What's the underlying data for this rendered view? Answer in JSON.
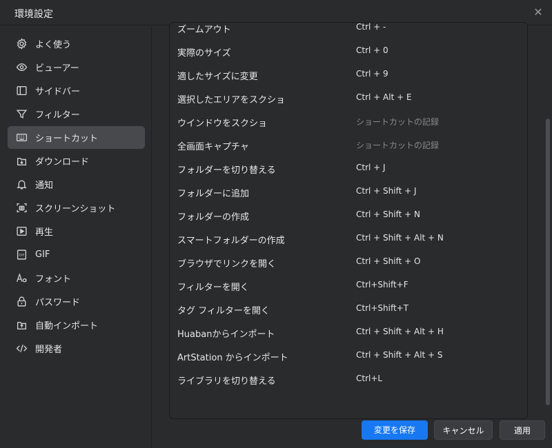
{
  "window": {
    "title": "環境設定",
    "close_icon": "close-icon"
  },
  "sidebar": {
    "items": [
      {
        "label": "よく使う",
        "icon": "gear-icon",
        "active": false
      },
      {
        "label": "ビューアー",
        "icon": "eye-icon",
        "active": false
      },
      {
        "label": "サイドバー",
        "icon": "sidebar-icon",
        "active": false
      },
      {
        "label": "フィルター",
        "icon": "filter-icon",
        "active": false
      },
      {
        "label": "ショートカット",
        "icon": "keyboard-icon",
        "active": true
      },
      {
        "label": "ダウンロード",
        "icon": "download-icon",
        "active": false
      },
      {
        "label": "通知",
        "icon": "bell-icon",
        "active": false
      },
      {
        "label": "スクリーンショット",
        "icon": "screenshot-icon",
        "active": false
      },
      {
        "label": "再生",
        "icon": "play-icon",
        "active": false
      },
      {
        "label": "GIF",
        "icon": "gif-icon",
        "active": false
      },
      {
        "label": "フォント",
        "icon": "font-icon",
        "active": false
      },
      {
        "label": "パスワード",
        "icon": "lock-icon",
        "active": false
      },
      {
        "label": "自動インポート",
        "icon": "import-icon",
        "active": false
      },
      {
        "label": "開発者",
        "icon": "code-icon",
        "active": false
      }
    ]
  },
  "shortcuts": [
    {
      "name": "ズームアウト",
      "key": "Ctrl + -",
      "placeholder": false
    },
    {
      "name": "実際のサイズ",
      "key": "Ctrl + 0",
      "placeholder": false
    },
    {
      "name": "適したサイズに変更",
      "key": "Ctrl + 9",
      "placeholder": false
    },
    {
      "name": "選択したエリアをスクショ",
      "key": "Ctrl + Alt + E",
      "placeholder": false
    },
    {
      "name": "ウインドウをスクショ",
      "key": "ショートカットの記録",
      "placeholder": true
    },
    {
      "name": "全画面キャプチャ",
      "key": "ショートカットの記録",
      "placeholder": true
    },
    {
      "name": "フォルダーを切り替える",
      "key": "Ctrl + J",
      "placeholder": false
    },
    {
      "name": "フォルダーに追加",
      "key": "Ctrl + Shift + J",
      "placeholder": false
    },
    {
      "name": "フォルダーの作成",
      "key": "Ctrl + Shift + N",
      "placeholder": false
    },
    {
      "name": "スマートフォルダーの作成",
      "key": "Ctrl + Shift + Alt + N",
      "placeholder": false
    },
    {
      "name": "ブラウザでリンクを開く",
      "key": "Ctrl + Shift + O",
      "placeholder": false
    },
    {
      "name": "フィルターを開く",
      "key": "Ctrl+Shift+F",
      "placeholder": false
    },
    {
      "name": "タグ フィルターを開く",
      "key": "Ctrl+Shift+T",
      "placeholder": false
    },
    {
      "name": "Huabanからインポート",
      "key": "Ctrl + Shift + Alt + H",
      "placeholder": false
    },
    {
      "name": "ArtStation からインポート",
      "key": "Ctrl + Shift + Alt + S",
      "placeholder": false
    },
    {
      "name": "ライブラリを切り替える",
      "key": "Ctrl+L",
      "placeholder": false
    }
  ],
  "footer": {
    "save_label": "変更を保存",
    "cancel_label": "キャンセル",
    "apply_label": "適用"
  },
  "colors": {
    "background": "#2a2b2d",
    "active_item": "#47494d",
    "primary": "#1778f2",
    "placeholder_text": "#8a8a8a"
  }
}
